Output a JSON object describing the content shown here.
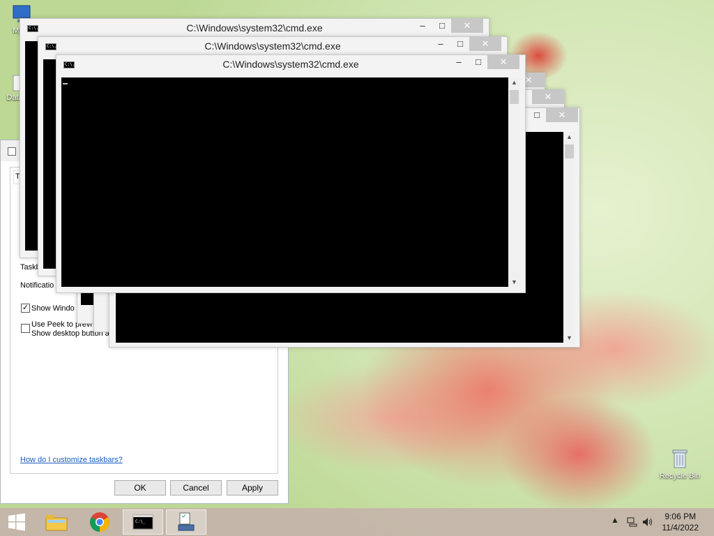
{
  "desktop": {
    "icons": [
      {
        "label": "My C",
        "name": "my-computer-icon"
      },
      {
        "label": "Data",
        "name": "data-folder-icon"
      },
      {
        "label": "Recycle Bin",
        "name": "recycle-bin-icon"
      }
    ]
  },
  "dialog": {
    "tab_label": "T",
    "taskbar_label": "Taskb",
    "notification_label": "Notificatio",
    "show_windows_label": "Show Windo",
    "show_windows_checked": true,
    "use_peek_label": "Use Peek to previ",
    "show_desktop_label": "Show desktop button a",
    "use_peek_checked": false,
    "help_link": "How do I customize taskbars?",
    "ok": "OK",
    "cancel": "Cancel",
    "apply": "Apply"
  },
  "cmd_windows": [
    {
      "title": "C:\\Windows\\system32\\cmd.exe",
      "icon_text": "C:\\."
    },
    {
      "title": "C:\\Windows\\system32\\cmd.exe",
      "icon_text": "C:\\."
    },
    {
      "title": "C:\\Windows\\system32\\cmd.exe",
      "icon_text": "C:\\."
    }
  ],
  "window_controls": {
    "minimize": "–",
    "maximize": "□",
    "close": "✕"
  },
  "taskbar": {
    "items": [
      "start-button",
      "file-explorer-icon",
      "chrome-icon",
      "cmd-icon",
      "control-panel-icon"
    ],
    "time": "9:06 PM",
    "date": "11/4/2022"
  }
}
